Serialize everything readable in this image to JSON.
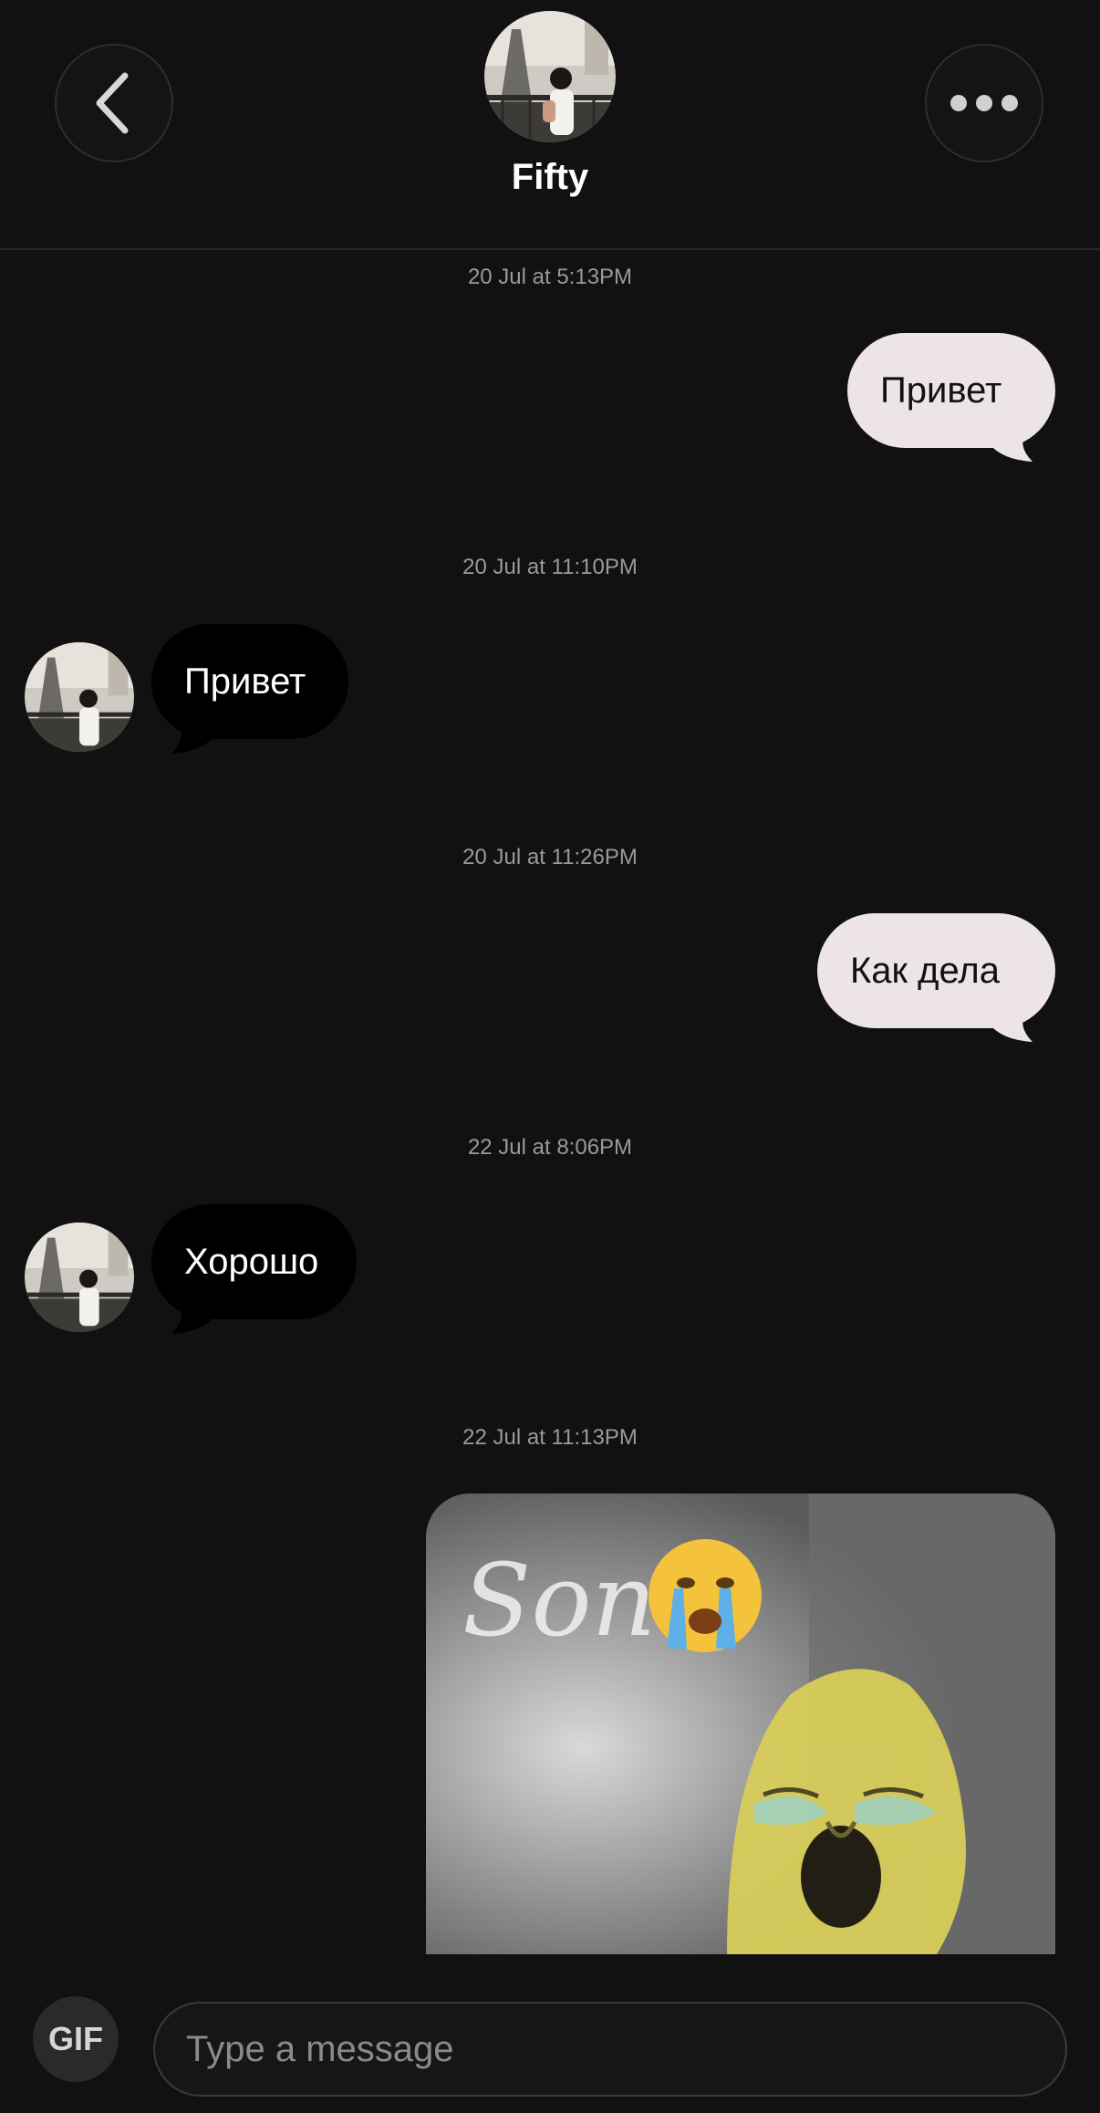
{
  "header": {
    "back_icon": "chevron-left-icon",
    "contact_name": "Fifty",
    "more_icon": "more-horizontal-icon"
  },
  "messages": [
    {
      "timestamp": "20 Jul at 5:13PM",
      "direction": "outgoing",
      "text": "Привет"
    },
    {
      "timestamp": "20 Jul at 11:10PM",
      "direction": "incoming",
      "text": "Привет"
    },
    {
      "timestamp": "20 Jul at 11:26PM",
      "direction": "outgoing",
      "text": "Как дела"
    },
    {
      "timestamp": "22 Jul at 8:06PM",
      "direction": "incoming",
      "text": "Хорошо"
    },
    {
      "timestamp": "22 Jul at 11:13PM",
      "direction": "outgoing",
      "type": "image",
      "image_text": "Son"
    }
  ],
  "composer": {
    "gif_label": "GIF",
    "placeholder": "Type a message"
  },
  "colors": {
    "background": "#111111",
    "outgoing_bubble": "#ece4e6",
    "incoming_bubble": "#000000",
    "timestamp": "#9a9a9a"
  }
}
